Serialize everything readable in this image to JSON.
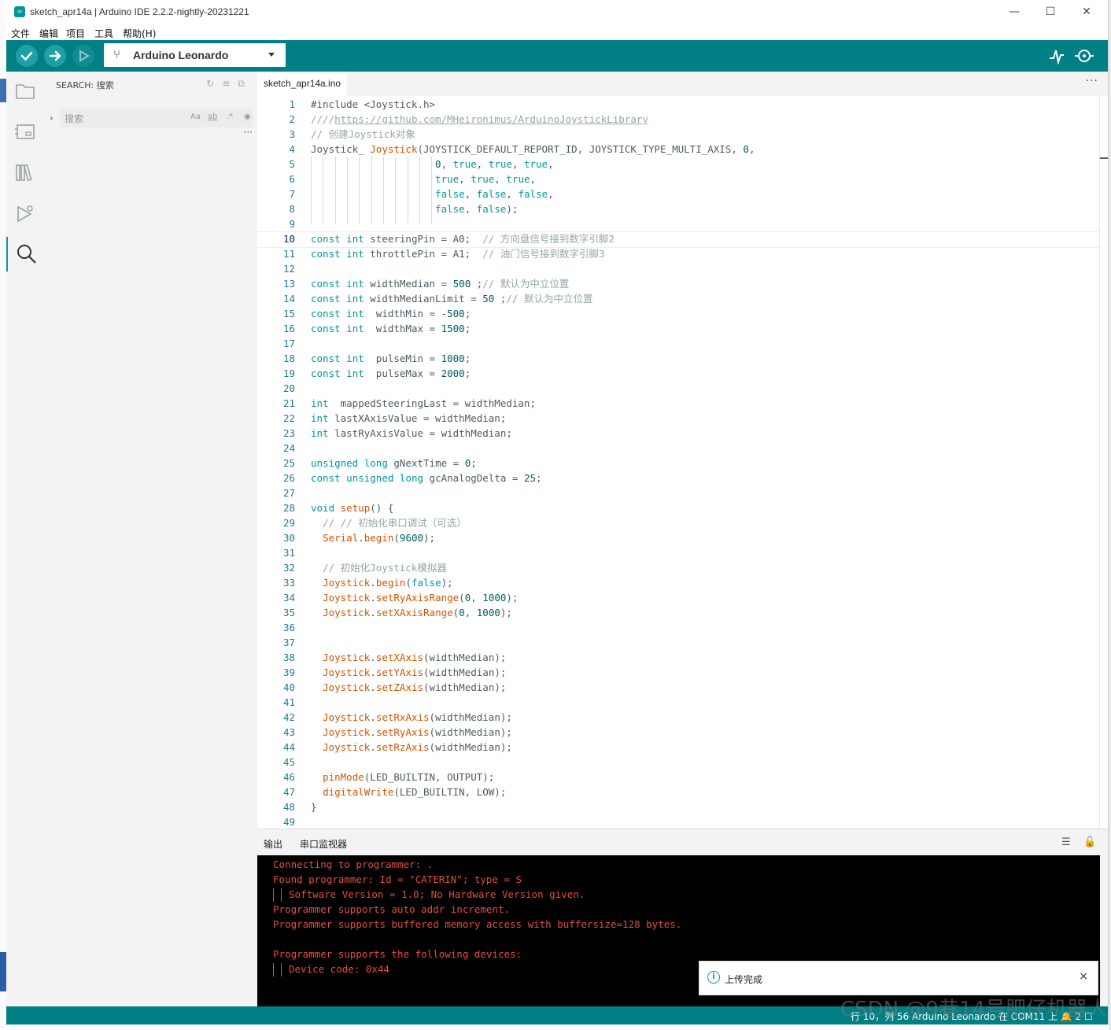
{
  "window": {
    "title": "sketch_apr14a | Arduino IDE 2.2.2-nightly-20231221",
    "minimize": "—",
    "maximize": "☐",
    "close": "✕"
  },
  "menu": [
    "文件",
    "编辑",
    "项目",
    "工具",
    "帮助(H)"
  ],
  "toolbar": {
    "board": "Arduino Leonardo",
    "buttons": [
      "verify-icon",
      "upload-icon",
      "debug-icon"
    ],
    "right_icons": [
      "serial-plotter-icon",
      "serial-monitor-icon"
    ],
    "accent": "#007f85"
  },
  "activity_icons": [
    "sketchbook-icon",
    "boards-manager-icon",
    "library-manager-icon",
    "debug-icon",
    "search-icon"
  ],
  "sidebar": {
    "header": "SEARCH: 搜索",
    "search_placeholder": "搜索",
    "options": [
      "Aa",
      "ab",
      ".*"
    ],
    "more": "···"
  },
  "tab": {
    "label": "sketch_apr14a.ino",
    "more": "···"
  },
  "editor": {
    "current_line": 10,
    "line_count": 49
  },
  "output_panel": {
    "tabs": [
      "输出",
      "串口监视器"
    ],
    "lines": [
      {
        "text": "Connecting to programmer: .",
        "indent": 0
      },
      {
        "text": "Found programmer: Id = \"CATERIN\"; type = S",
        "indent": 0
      },
      {
        "text": "Software Version = 1.0; No Hardware Version given.",
        "indent": 2
      },
      {
        "text": "Programmer supports auto addr increment.",
        "indent": 0
      },
      {
        "text": "Programmer supports buffered memory access with buffersize=128 bytes.",
        "indent": 0
      },
      {
        "text": "",
        "indent": 0
      },
      {
        "text": "Programmer supports the following devices:",
        "indent": 0
      },
      {
        "text": "Device code: 0x44",
        "indent": 2
      }
    ]
  },
  "notification": {
    "message": "上传完成",
    "close": "×"
  },
  "statusbar": {
    "text": "行 10，列 56   Arduino Leonardo 在 COM11 上   🔔 2   ☐"
  },
  "watermark": "CSDN @9巷14号肥仔机器人"
}
